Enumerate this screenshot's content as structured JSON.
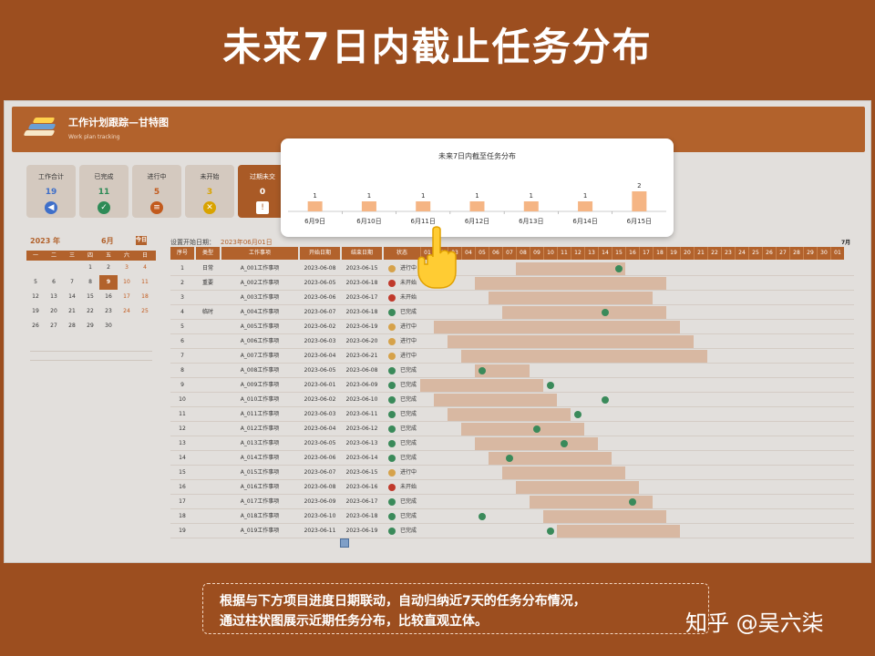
{
  "page_title": "未来7日内截止任务分布",
  "app": {
    "title": "工作计划跟踪—甘特图",
    "subtitle": "Work plan tracking"
  },
  "kpis": [
    {
      "label": "工作合计",
      "value": "19",
      "color": "#3f6fc9",
      "icon": "sound-icon"
    },
    {
      "label": "已完成",
      "value": "11",
      "color": "#2e8b57",
      "icon": "check-circle-icon"
    },
    {
      "label": "进行中",
      "value": "5",
      "color": "#c25a1d",
      "icon": "list-icon"
    },
    {
      "label": "未开始",
      "value": "3",
      "color": "#d9a300",
      "icon": "x-circle-icon"
    },
    {
      "label": "过期未交",
      "value": "0",
      "color": "#ffffff",
      "icon": "warning-icon"
    }
  ],
  "calendar": {
    "year": "2023 年",
    "month": "6月",
    "button": "今日",
    "weekdays": [
      "一",
      "二",
      "三",
      "四",
      "五",
      "六",
      "日"
    ],
    "rows": [
      [
        "",
        "",
        "",
        "1",
        "2",
        "3",
        "4"
      ],
      [
        "5",
        "6",
        "7",
        "8",
        "9",
        "10",
        "11"
      ],
      [
        "12",
        "13",
        "14",
        "15",
        "16",
        "17",
        "18"
      ],
      [
        "19",
        "20",
        "21",
        "22",
        "23",
        "24",
        "25"
      ],
      [
        "26",
        "27",
        "28",
        "29",
        "30",
        "",
        ""
      ]
    ],
    "today": "9"
  },
  "gantt": {
    "start_label": "设置开始日期：",
    "start_date": "2023年06月01日",
    "month_label_right": "7月",
    "columns": [
      "序号",
      "类型",
      "工作事项",
      "开始日期",
      "结束日期",
      "状态"
    ],
    "days": [
      "01",
      "02",
      "03",
      "04",
      "05",
      "06",
      "07",
      "08",
      "09",
      "10",
      "11",
      "12",
      "13",
      "14",
      "15",
      "16",
      "17",
      "18",
      "19",
      "20",
      "21",
      "22",
      "23",
      "24",
      "25",
      "26",
      "27",
      "28",
      "29",
      "30",
      "01"
    ],
    "rows": [
      {
        "no": "1",
        "type": "日常",
        "task": "A_001工作事项",
        "start": "2023-06-08",
        "end": "2023-06-15",
        "status": "进行中",
        "dot": "#d6a24a"
      },
      {
        "no": "2",
        "type": "重要",
        "task": "A_002工作事项",
        "start": "2023-06-05",
        "end": "2023-06-18",
        "status": "未开始",
        "dot": "#c0392b"
      },
      {
        "no": "3",
        "type": "",
        "task": "A_003工作事项",
        "start": "2023-06-06",
        "end": "2023-06-17",
        "status": "未开始",
        "dot": "#c0392b"
      },
      {
        "no": "4",
        "type": "临时",
        "task": "A_004工作事项",
        "start": "2023-06-07",
        "end": "2023-06-18",
        "status": "已完成",
        "dot": "#3a8a5a"
      },
      {
        "no": "5",
        "type": "",
        "task": "A_005工作事项",
        "start": "2023-06-02",
        "end": "2023-06-19",
        "status": "进行中",
        "dot": "#d6a24a"
      },
      {
        "no": "6",
        "type": "",
        "task": "A_006工作事项",
        "start": "2023-06-03",
        "end": "2023-06-20",
        "status": "进行中",
        "dot": "#d6a24a"
      },
      {
        "no": "7",
        "type": "",
        "task": "A_007工作事项",
        "start": "2023-06-04",
        "end": "2023-06-21",
        "status": "进行中",
        "dot": "#d6a24a"
      },
      {
        "no": "8",
        "type": "",
        "task": "A_008工作事项",
        "start": "2023-06-05",
        "end": "2023-06-08",
        "status": "已完成",
        "dot": "#3a8a5a"
      },
      {
        "no": "9",
        "type": "",
        "task": "A_009工作事项",
        "start": "2023-06-01",
        "end": "2023-06-09",
        "status": "已完成",
        "dot": "#3a8a5a"
      },
      {
        "no": "10",
        "type": "",
        "task": "A_010工作事项",
        "start": "2023-06-02",
        "end": "2023-06-10",
        "status": "已完成",
        "dot": "#3a8a5a"
      },
      {
        "no": "11",
        "type": "",
        "task": "A_011工作事项",
        "start": "2023-06-03",
        "end": "2023-06-11",
        "status": "已完成",
        "dot": "#3a8a5a"
      },
      {
        "no": "12",
        "type": "",
        "task": "A_012工作事项",
        "start": "2023-06-04",
        "end": "2023-06-12",
        "status": "已完成",
        "dot": "#3a8a5a"
      },
      {
        "no": "13",
        "type": "",
        "task": "A_013工作事项",
        "start": "2023-06-05",
        "end": "2023-06-13",
        "status": "已完成",
        "dot": "#3a8a5a"
      },
      {
        "no": "14",
        "type": "",
        "task": "A_014工作事项",
        "start": "2023-06-06",
        "end": "2023-06-14",
        "status": "已完成",
        "dot": "#3a8a5a"
      },
      {
        "no": "15",
        "type": "",
        "task": "A_015工作事项",
        "start": "2023-06-07",
        "end": "2023-06-15",
        "status": "进行中",
        "dot": "#d6a24a"
      },
      {
        "no": "16",
        "type": "",
        "task": "A_016工作事项",
        "start": "2023-06-08",
        "end": "2023-06-16",
        "status": "未开始",
        "dot": "#c0392b"
      },
      {
        "no": "17",
        "type": "",
        "task": "A_017工作事项",
        "start": "2023-06-09",
        "end": "2023-06-17",
        "status": "已完成",
        "dot": "#3a8a5a"
      },
      {
        "no": "18",
        "type": "",
        "task": "A_018工作事项",
        "start": "2023-06-10",
        "end": "2023-06-18",
        "status": "已完成",
        "dot": "#3a8a5a"
      },
      {
        "no": "19",
        "type": "",
        "task": "A_019工作事项",
        "start": "2023-06-11",
        "end": "2023-06-19",
        "status": "已完成",
        "dot": "#3a8a5a"
      }
    ]
  },
  "chart_data": {
    "type": "bar",
    "title": "未来7日内截至任务分布",
    "categories": [
      "6月9日",
      "6月10日",
      "6月11日",
      "6月12日",
      "6月13日",
      "6月14日",
      "6月15日"
    ],
    "values": [
      1,
      1,
      1,
      1,
      1,
      1,
      2
    ],
    "ylim": [
      0,
      2
    ],
    "bar_color": "#f5b584",
    "grid": false
  },
  "caption": {
    "line1": "根据与下方项目进度日期联动，自动归纳近7天的任务分布情况，",
    "line2": "通过柱状图展示近期任务分布，比较直观立体。"
  },
  "watermark": "知乎 @吴六柒"
}
